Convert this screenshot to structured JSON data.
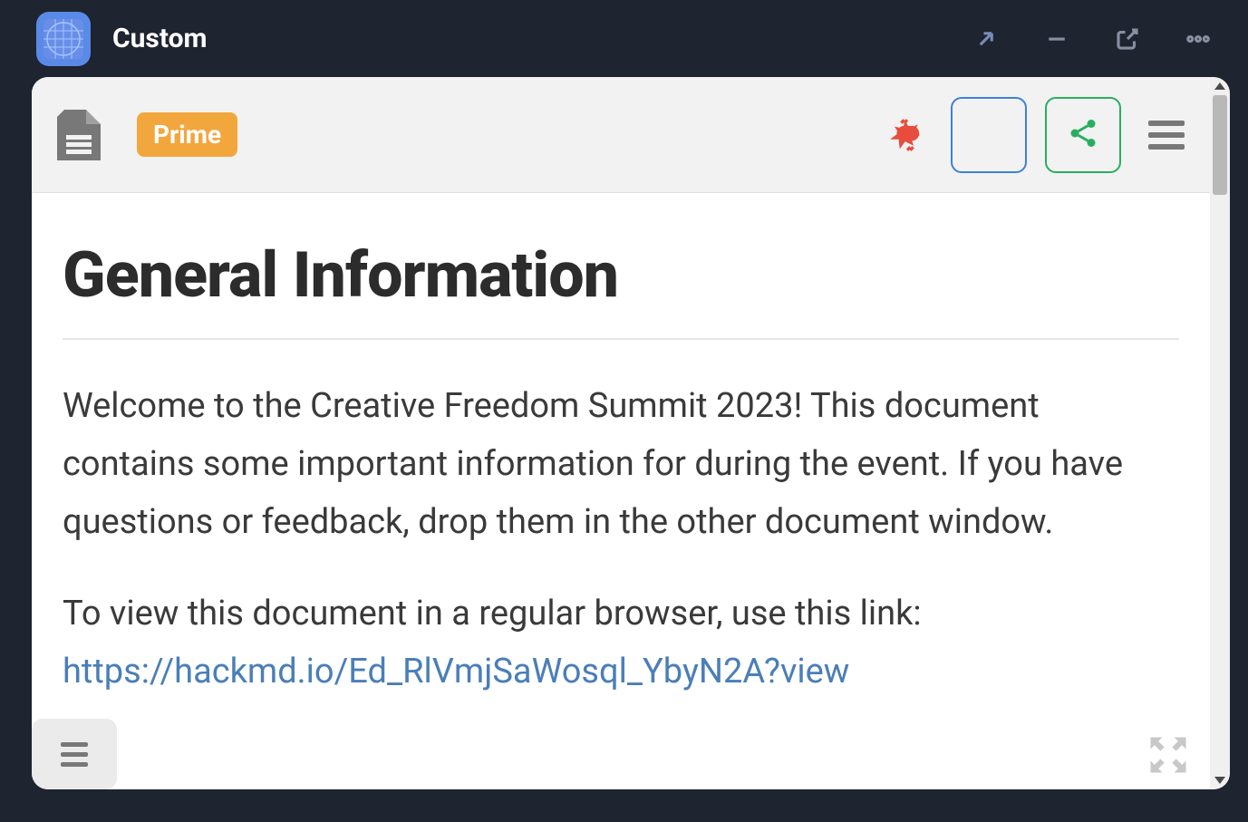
{
  "window": {
    "title": "Custom"
  },
  "toolbar": {
    "prime_label": "Prime"
  },
  "document": {
    "title": "General Information",
    "para1": "Welcome to the Creative Freedom Summit 2023! This document contains some important information for during the event. If you have questions or feedback, drop them in the other document window.",
    "para2_prefix": "To view this document in a regular browser, use this link:",
    "link": "https://hackmd.io/Ed_RlVmjSaWosql_YbyN2A?view"
  }
}
